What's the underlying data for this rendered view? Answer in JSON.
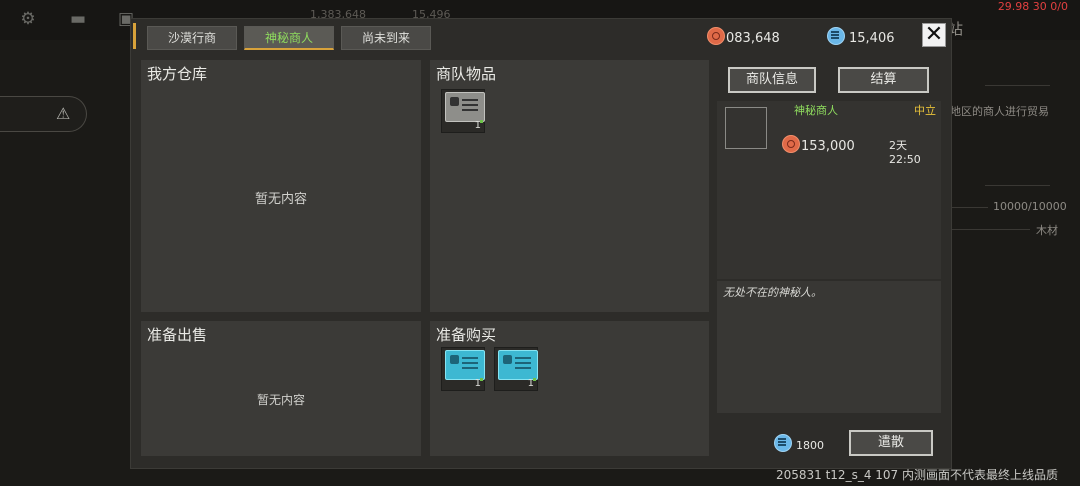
{
  "background": {
    "top_currency_1": "1,383,648",
    "top_currency_2": "15,496",
    "status_text": "29.98 30 0/0",
    "side_text_1": "站",
    "side_text_2": "地区的商人进行贸易",
    "side_text_3": "10000/10000",
    "side_text_4": "木材",
    "version_text": "205831 t12_s_4 107 内测画面不代表最终上线品质"
  },
  "tabs": [
    {
      "label": "沙漠行商",
      "active": false
    },
    {
      "label": "神秘商人",
      "active": true
    },
    {
      "label": "尚未到来",
      "active": false
    }
  ],
  "currency": {
    "coins": "083,648",
    "gems": "15,406"
  },
  "close_label": "✕",
  "panels": {
    "my_warehouse": {
      "title": "我方仓库",
      "empty": "暂无内容"
    },
    "caravan_items": {
      "title": "商队物品",
      "items": [
        {
          "icon": "grey-card-icon",
          "count": "1"
        }
      ]
    },
    "prepare_sell": {
      "title": "准备出售",
      "empty": "暂无内容"
    },
    "prepare_buy": {
      "title": "准备购买",
      "items": [
        {
          "icon": "blue-card-icon",
          "count": "1"
        },
        {
          "icon": "blue-card-icon",
          "count": "1"
        }
      ]
    }
  },
  "buttons": {
    "caravan_info": "商队信息",
    "settle": "结算",
    "dismiss": "遣散"
  },
  "merchant": {
    "name": "神秘商人",
    "stance": "中立",
    "price": "153,000",
    "time_left": "2天 22:50",
    "description": "无处不在的神秘人。"
  },
  "dismiss_cost": "1800",
  "colors": {
    "accent": "#d8a23a",
    "active_tab_text": "#8fdc5e",
    "merchant_name": "#8fdc5e",
    "stance": "#e8c23a"
  }
}
